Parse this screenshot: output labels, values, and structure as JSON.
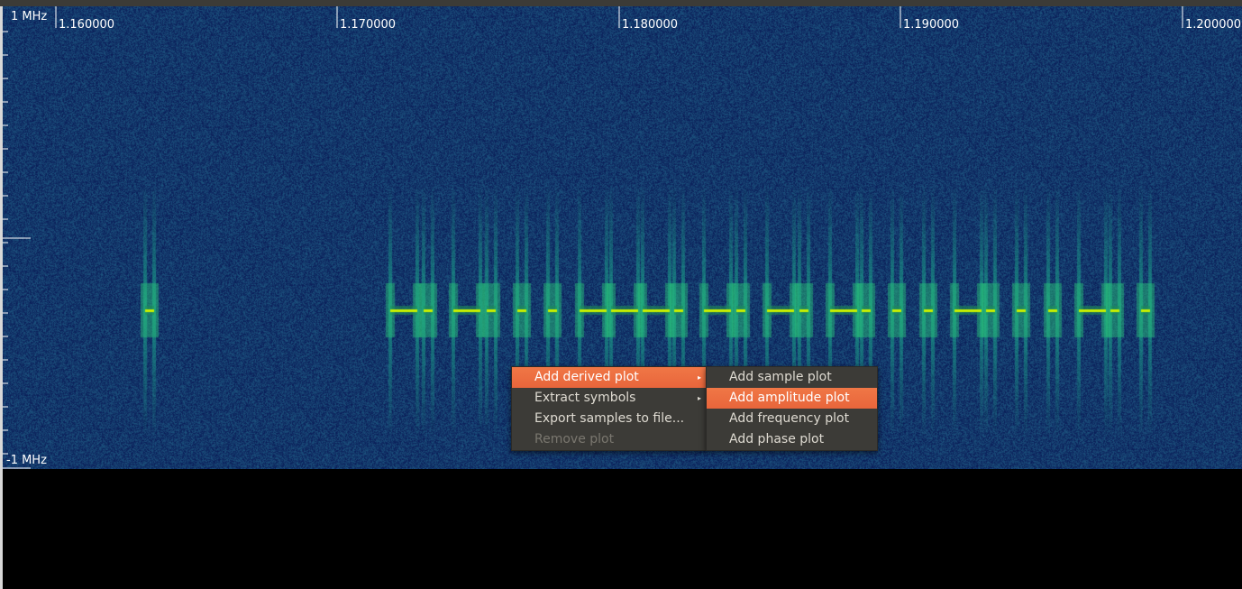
{
  "spectrogram": {
    "time_axis_labels": [
      "1.160000",
      "1.170000",
      "1.180000",
      "1.190000",
      "1.200000"
    ],
    "freq_top_label": "1 MHz",
    "freq_bottom_label": "-1 MHz",
    "colors": {
      "background": "#0c2350",
      "noise_light": "#1d4a73",
      "signal_core": "#c8f000",
      "signal_halo": "#1ba58a"
    }
  },
  "context_menu": {
    "items": [
      {
        "label": "Add derived plot",
        "has_submenu": true,
        "state": "highlighted"
      },
      {
        "label": "Extract symbols",
        "has_submenu": true,
        "state": "normal"
      },
      {
        "label": "Export samples to file...",
        "has_submenu": false,
        "state": "normal"
      },
      {
        "label": "Remove plot",
        "has_submenu": false,
        "state": "disabled"
      }
    ],
    "submenu_arrow": "▸"
  },
  "derived_plot_submenu": {
    "items": [
      {
        "label": "Add sample plot",
        "state": "normal"
      },
      {
        "label": "Add amplitude plot",
        "state": "highlighted"
      },
      {
        "label": "Add frequency plot",
        "state": "normal"
      },
      {
        "label": "Add phase plot",
        "state": "normal"
      }
    ]
  },
  "menu_colors": {
    "background": "#3c3b37",
    "text": "#dfdbd2",
    "highlight": "#f07746",
    "disabled_text": "#7a776f"
  }
}
